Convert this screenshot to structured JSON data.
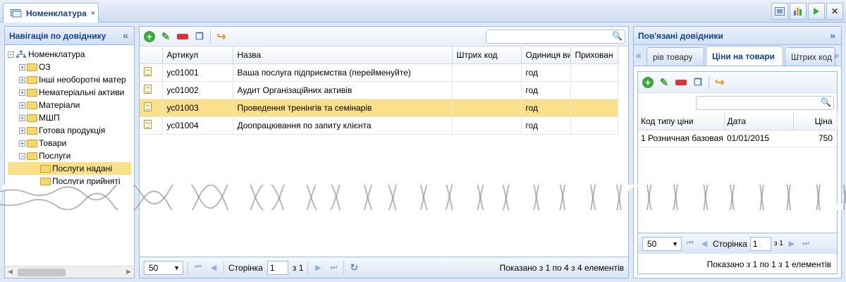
{
  "window": {
    "tab_title": "Номенклатура",
    "close_glyph": "×",
    "toolbar_icons": [
      "export-icon",
      "chart-icon",
      "play-icon",
      "close-icon"
    ]
  },
  "nav": {
    "title": "Навігація по довіднику",
    "collapse_glyph": "«",
    "root": "Номенклатура",
    "items": [
      {
        "label": "ОЗ",
        "expanded": false
      },
      {
        "label": "Інші необоротні матер",
        "expanded": false
      },
      {
        "label": "Нематеріальні активи",
        "expanded": false
      },
      {
        "label": "Матеріали",
        "expanded": false
      },
      {
        "label": "МШП",
        "expanded": false
      },
      {
        "label": "Готова продукція",
        "expanded": false
      },
      {
        "label": "Товари",
        "expanded": false
      },
      {
        "label": "Послуги",
        "expanded": true
      }
    ],
    "children": [
      {
        "label": "Послуги надані",
        "selected": true
      },
      {
        "label": "Послуги прийняті",
        "selected": false
      }
    ]
  },
  "grid": {
    "search_placeholder": "",
    "columns": [
      "Артикул",
      "Назва",
      "Штрих код",
      "Одиниця ви",
      "Прихован"
    ],
    "rows": [
      {
        "sku": "ус01001",
        "name": "Ваша послуга підприємства (перейменуйте)",
        "barcode": "",
        "unit": "год",
        "hidden": ""
      },
      {
        "sku": "ус01002",
        "name": "Аудит Організаційних активів",
        "barcode": "",
        "unit": "год",
        "hidden": ""
      },
      {
        "sku": "ус01003",
        "name": "Проведення тренінгів та семінарів",
        "barcode": "",
        "unit": "год",
        "hidden": "",
        "selected": true
      },
      {
        "sku": "ус01004",
        "name": "Доопрацювання по запиту клієнта",
        "barcode": "",
        "unit": "год",
        "hidden": ""
      }
    ],
    "pager": {
      "page_size": "50",
      "page_label": "Сторінка",
      "page": "1",
      "of_label": "з 1",
      "info": "Показано з 1 по 4 з 4 елементів"
    }
  },
  "related": {
    "title": "Пов'язані довідники",
    "collapse_glyph": "»",
    "tabs": [
      "рів товару",
      "Ціни на товари",
      "Штрих код"
    ],
    "active_tab": 1,
    "columns": [
      "Код типу ціни",
      "Дата",
      "Ціна"
    ],
    "rows": [
      {
        "code": "1 Розничная базовая",
        "date": "01/01/2015",
        "price": "750"
      }
    ],
    "pager": {
      "page_size": "50",
      "page_label": "Сторінка",
      "page": "1",
      "of_label": "з 1",
      "info": "Показано з 1 по 1 з 1 елементів"
    }
  }
}
